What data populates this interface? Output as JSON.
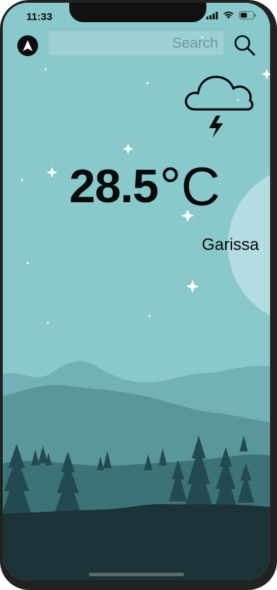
{
  "status_bar": {
    "time": "11:33",
    "icons": [
      "signal-icon",
      "wifi-icon",
      "battery-icon"
    ]
  },
  "search": {
    "placeholder": "Search",
    "value": "",
    "nav_icon": "navigation-arrow-icon",
    "search_icon": "magnifier-icon"
  },
  "weather": {
    "condition_icon": "thunderstorm-cloud-icon",
    "temperature": "28.5",
    "unit": "°C",
    "city": "Garissa"
  },
  "colors": {
    "sky": "#8ac9cb",
    "moon": "#b3dde0",
    "far_hills": "#72b2b6",
    "mid_hills": "#5a979b",
    "near_hills": "#3b7376",
    "trees": "#224a4f",
    "ground": "#1b3337"
  }
}
